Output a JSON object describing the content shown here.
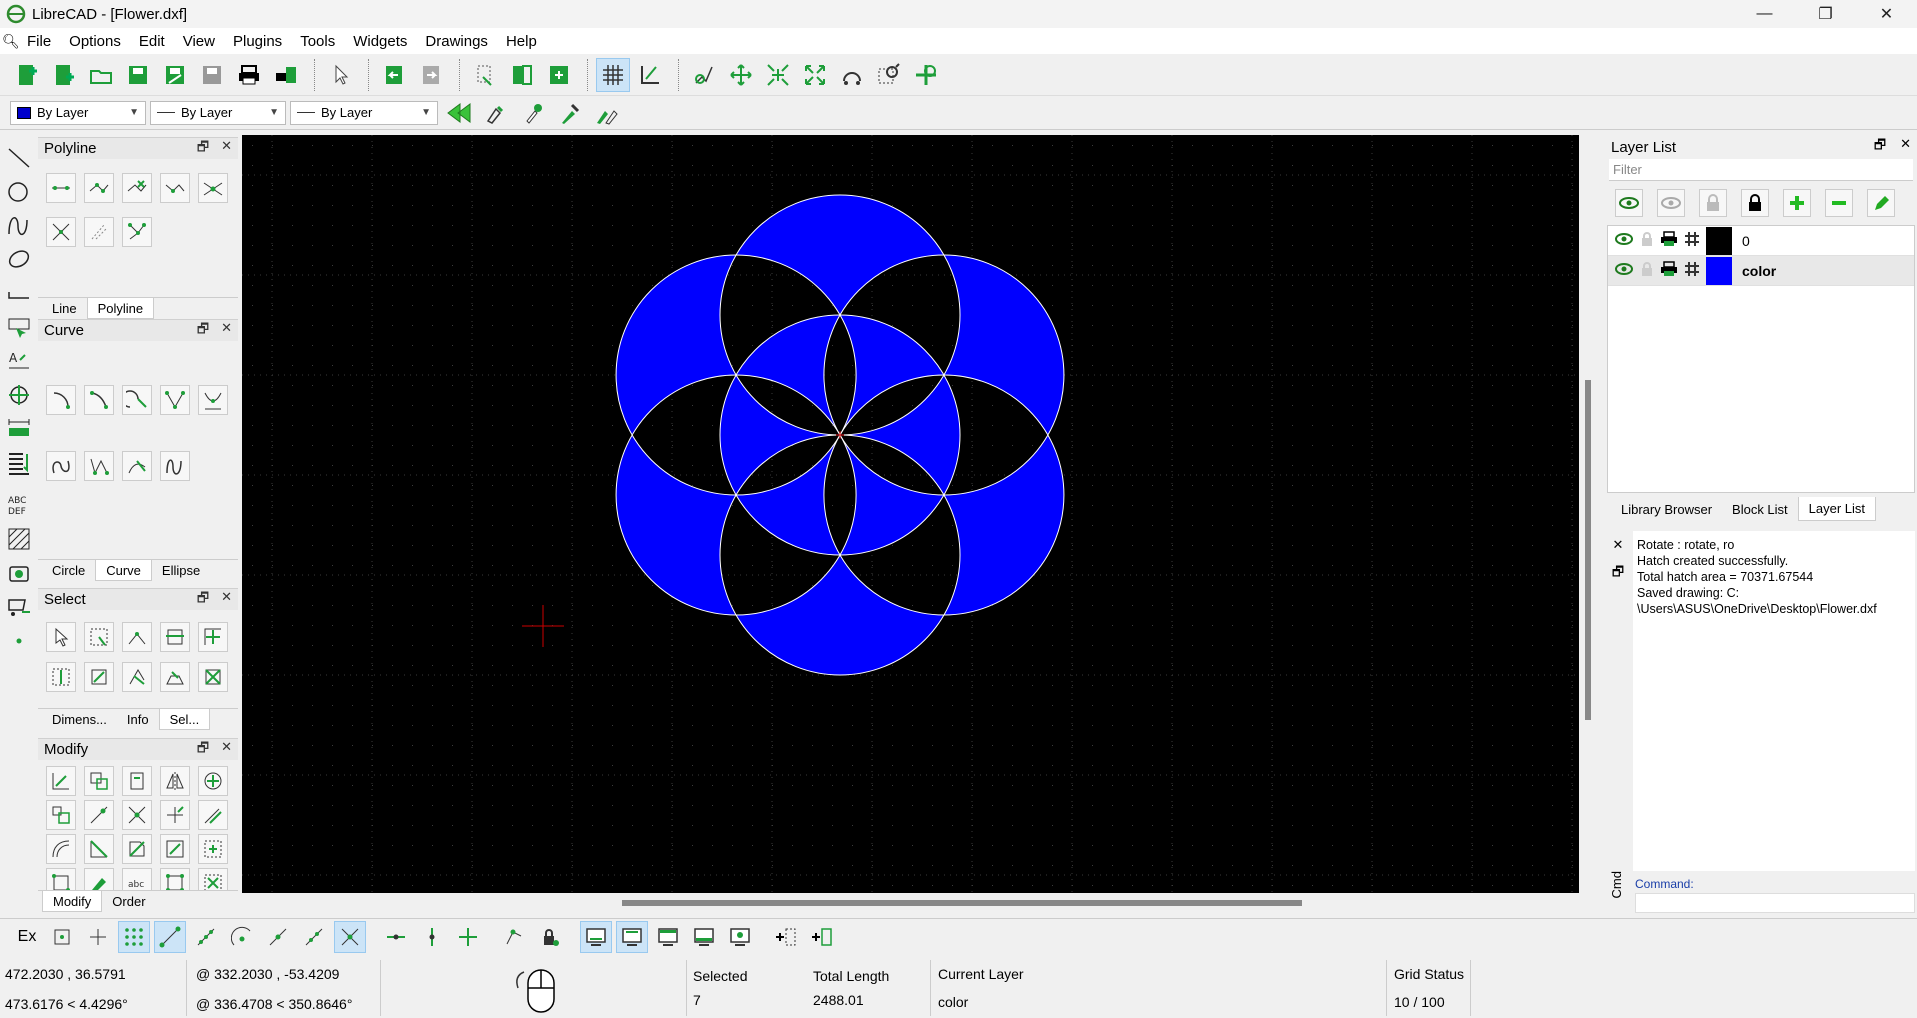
{
  "window": {
    "title": "LibreCAD - [Flower.dxf]",
    "minimize": "—",
    "restore": "❐",
    "close": "✕"
  },
  "menu": {
    "items": [
      "File",
      "Options",
      "Edit",
      "View",
      "Plugins",
      "Tools",
      "Widgets",
      "Drawings",
      "Help"
    ]
  },
  "pen_toolbar": {
    "color": "By Layer",
    "line_type": "By Layer",
    "line_width": "By Layer",
    "color_swatch": "#0000cc"
  },
  "docks": {
    "polyline": {
      "title": "Polyline",
      "tabs": [
        "Line",
        "Polyline"
      ],
      "selected_tab": "Polyline"
    },
    "curve": {
      "title": "Curve",
      "tabs": [
        "Circle",
        "Curve",
        "Ellipse"
      ],
      "selected_tab": "Curve"
    },
    "select": {
      "title": "Select",
      "tabs": [
        "Dimens...",
        "Info",
        "Sel..."
      ],
      "selected_tab": "Sel..."
    },
    "modify": {
      "title": "Modify",
      "tabs": [
        "Modify",
        "Order"
      ],
      "selected_tab": "Modify"
    }
  },
  "drawing": {
    "fill_color": "#0000ff",
    "stroke_color": "#ffffff",
    "background": "#000000",
    "grid_color": "#3a3a3a",
    "cursor_color": "#cc0000"
  },
  "layer_panel": {
    "title": "Layer List",
    "filter_placeholder": "Filter",
    "layers": [
      {
        "name": "0",
        "color": "#000000",
        "selected": false
      },
      {
        "name": "color",
        "color": "#0000ff",
        "selected": true
      }
    ],
    "tabs": [
      "Library Browser",
      "Block List",
      "Layer List"
    ],
    "selected_tab": "Layer List"
  },
  "command": {
    "output": [
      "Rotate : rotate, ro",
      "Hatch created successfully.",
      "Total hatch area =  70371.67544",
      "Saved drawing: C:",
      "\\Users\\ASUS\\OneDrive\\Desktop\\Flower.dxf"
    ],
    "label": "Command:",
    "side_label": "Cmd"
  },
  "snapbar": {
    "ex_label": "Ex"
  },
  "status": {
    "abs_coord": "472.2030 , 36.5791",
    "abs_polar": "473.6176 < 4.4296°",
    "rel_coord": "@  332.2030 , -53.4209",
    "rel_polar": "@  336.4708 < 350.8646°",
    "selected_label": "Selected",
    "selected_value": "7",
    "total_length_label": "Total Length",
    "total_length_value": "2488.01",
    "current_layer_label": "Current Layer",
    "current_layer_value": "color",
    "grid_status_label": "Grid Status",
    "grid_status_value": "10 / 100"
  }
}
